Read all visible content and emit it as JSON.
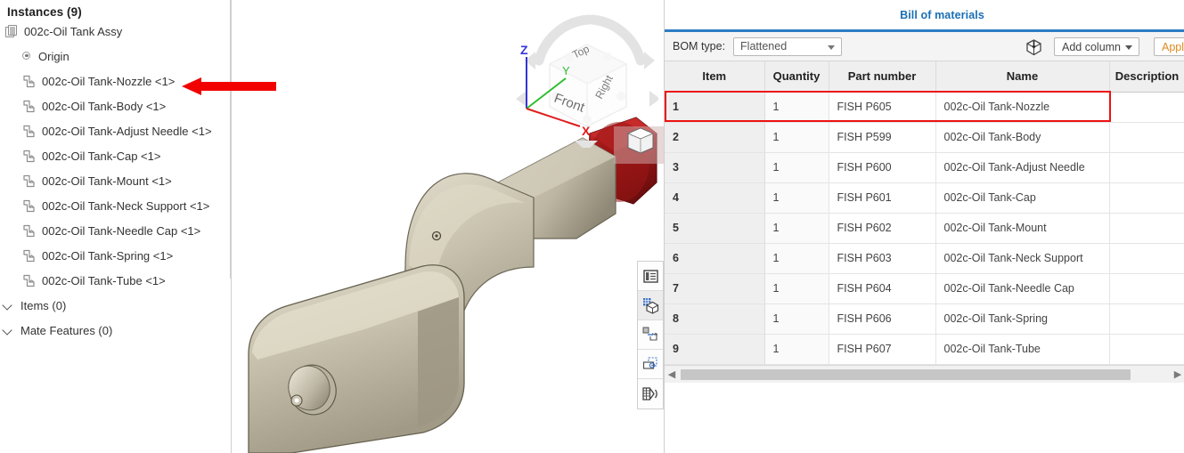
{
  "tree": {
    "title": "Instances (9)",
    "root": {
      "label": "002c-Oil Tank Assy",
      "icon": "assembly-icon"
    },
    "origin": {
      "label": "Origin",
      "icon": "origin-icon"
    },
    "instances": [
      {
        "label": "002c-Oil Tank-Nozzle <1>",
        "icon": "part-icon"
      },
      {
        "label": "002c-Oil Tank-Body <1>",
        "icon": "part-icon"
      },
      {
        "label": "002c-Oil Tank-Adjust Needle <1>",
        "icon": "part-icon"
      },
      {
        "label": "002c-Oil Tank-Cap <1>",
        "icon": "part-icon"
      },
      {
        "label": "002c-Oil Tank-Mount <1>",
        "icon": "part-icon"
      },
      {
        "label": "002c-Oil Tank-Neck Support <1>",
        "icon": "part-icon"
      },
      {
        "label": "002c-Oil Tank-Needle Cap <1>",
        "icon": "part-icon"
      },
      {
        "label": "002c-Oil Tank-Spring <1>",
        "icon": "part-icon"
      },
      {
        "label": "002c-Oil Tank-Tube <1>",
        "icon": "part-icon"
      }
    ],
    "sections": [
      {
        "label": "Items (0)",
        "icon": "chevron-down-icon"
      },
      {
        "label": "Mate Features (0)",
        "icon": "chevron-down-icon"
      }
    ],
    "toggle_icon": "tree-list-icon"
  },
  "viewport": {
    "viewcube": {
      "faces": {
        "top": "Top",
        "front": "Front",
        "right": "Right"
      },
      "icon": "view-cube-icon"
    },
    "triad": {
      "x_label": "X",
      "y_label": "Y",
      "z_label": "Z",
      "x_color": "#e11b1b",
      "y_color": "#2fbe2f",
      "z_color": "#3535d8"
    },
    "model": {
      "body_color": "#c2bba6",
      "highlight_color": "#b51a1a"
    },
    "toolbar": [
      {
        "icon": "display-list-icon"
      },
      {
        "icon": "section-view-icon",
        "active": true
      },
      {
        "icon": "explode-icon"
      },
      {
        "icon": "render-box-icon"
      },
      {
        "icon": "measure-icon"
      }
    ],
    "annotation": {
      "icon": "red-arrow-left-icon",
      "color": "#f20000"
    }
  },
  "bom": {
    "title": "Bill of materials",
    "title_color": "#1a6fb5",
    "toolbar": {
      "bom_type_label": "BOM type:",
      "bom_type_value": "Flattened",
      "export_icon": "export-cube-icon",
      "add_column_label": "Add column",
      "apply_label": "Apply"
    },
    "columns": [
      "Item",
      "Quantity",
      "Part number",
      "Name",
      "Description"
    ],
    "rows": [
      {
        "item": "1",
        "quantity": "1",
        "part_number": "FISH P605",
        "name": "002c-Oil Tank-Nozzle",
        "description": "",
        "highlighted": true
      },
      {
        "item": "2",
        "quantity": "1",
        "part_number": "FISH P599",
        "name": "002c-Oil Tank-Body",
        "description": ""
      },
      {
        "item": "3",
        "quantity": "1",
        "part_number": "FISH P600",
        "name": "002c-Oil Tank-Adjust Needle",
        "description": ""
      },
      {
        "item": "4",
        "quantity": "1",
        "part_number": "FISH P601",
        "name": "002c-Oil Tank-Cap",
        "description": ""
      },
      {
        "item": "5",
        "quantity": "1",
        "part_number": "FISH P602",
        "name": "002c-Oil Tank-Mount",
        "description": ""
      },
      {
        "item": "6",
        "quantity": "1",
        "part_number": "FISH P603",
        "name": "002c-Oil Tank-Neck Support",
        "description": ""
      },
      {
        "item": "7",
        "quantity": "1",
        "part_number": "FISH P604",
        "name": "002c-Oil Tank-Needle Cap",
        "description": ""
      },
      {
        "item": "8",
        "quantity": "1",
        "part_number": "FISH P606",
        "name": "002c-Oil Tank-Spring",
        "description": ""
      },
      {
        "item": "9",
        "quantity": "1",
        "part_number": "FISH P607",
        "name": "002c-Oil Tank-Tube",
        "description": ""
      }
    ],
    "highlight_color": "#ee1111",
    "scrollbar": {
      "left_arrow": "◀",
      "right_arrow": "▶"
    }
  }
}
